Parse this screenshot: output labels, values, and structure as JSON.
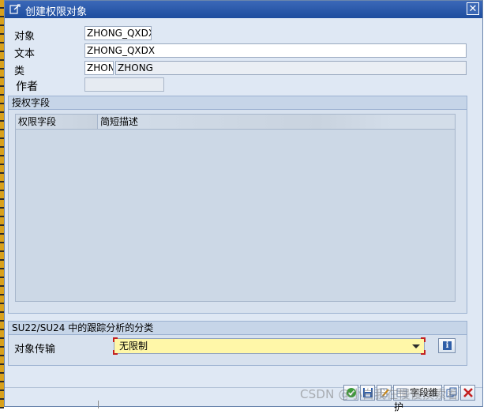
{
  "window": {
    "title": "创建权限对象",
    "title_icon": "object-create-icon",
    "close_icon": "close-icon"
  },
  "form": {
    "object_label": "对象",
    "object_value": "ZHONG_QXDX",
    "text_label": "文本",
    "text_value": "ZHONG_QXDX",
    "class_label": "类",
    "class_value": "ZHON",
    "class_description": "ZHONG",
    "author_label": "作者",
    "author_value": ""
  },
  "auth_fields": {
    "group_title": "授权字段",
    "columns": [
      "权限字段",
      "简短描述"
    ],
    "rows": []
  },
  "classification": {
    "group_title": "SU22/SU24 中的跟踪分析的分类",
    "transport_label": "对象传输",
    "transport_value": "无限制",
    "info_icon": "info-icon"
  },
  "toolbar": {
    "field_maintenance_label": "字段维护",
    "icons": [
      "check-icon",
      "save-icon",
      "edit-icon",
      "field-maintenance-icon",
      "copy-icon",
      "cancel-icon"
    ]
  },
  "watermark": "CSDN @小白我在慢慢摸索着",
  "colors": {
    "titlebar": "#2a5aa8",
    "dropdown_bg": "#fff7a8",
    "window_bg": "#dfe8f4",
    "accent_red": "#c32020"
  }
}
